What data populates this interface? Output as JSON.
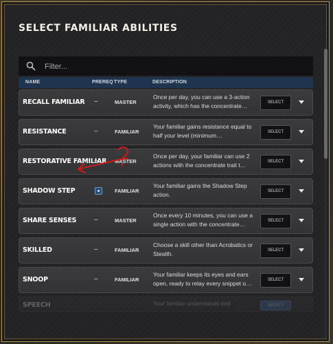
{
  "dialog": {
    "title": "SELECT FAMILIAR ABILITIES"
  },
  "search": {
    "placeholder": "Filter..."
  },
  "columns": {
    "name": "NAME",
    "prereq": "PREREQ",
    "type": "TYPE",
    "description": "DESCRIPTION"
  },
  "select_label": "SELECT",
  "rows": [
    {
      "name": "RECALL FAMILIAR",
      "prereq": "–",
      "type": "MASTER",
      "description": "Once per day, you can use a 3-action activity, which has the concentrate…"
    },
    {
      "name": "RESISTANCE",
      "prereq": "–",
      "type": "FAMILIAR",
      "description": "Your familiar gains resistance equal to half your level (minimum…"
    },
    {
      "name": "RESTORATIVE FAMILIAR",
      "prereq": "–",
      "type": "MASTER",
      "description": "Once per day, your familiar can use 2 actions with the concentrate trait t…"
    },
    {
      "name": "SHADOW STEP",
      "prereq": "",
      "type": "FAMILIAR",
      "description": "Your familiar gains the Shadow Step action."
    },
    {
      "name": "SHARE SENSES",
      "prereq": "–",
      "type": "MASTER",
      "description": "Once every 10 minutes, you can use a single action with the concentrate…"
    },
    {
      "name": "SKILLED",
      "prereq": "–",
      "type": "FAMILIAR",
      "description": "Choose a skill other than Acrobatics or Stealth."
    },
    {
      "name": "SNOOP",
      "prereq": "–",
      "type": "FAMILIAR",
      "description": "Your familiar keeps its eyes and ears open, ready to relay every snippet o…"
    },
    {
      "name": "SPEECH",
      "prereq": "",
      "type": "",
      "description": "Your familiar understands and"
    }
  ],
  "annotation": {
    "color": "#d11a1a",
    "mark": "?"
  }
}
